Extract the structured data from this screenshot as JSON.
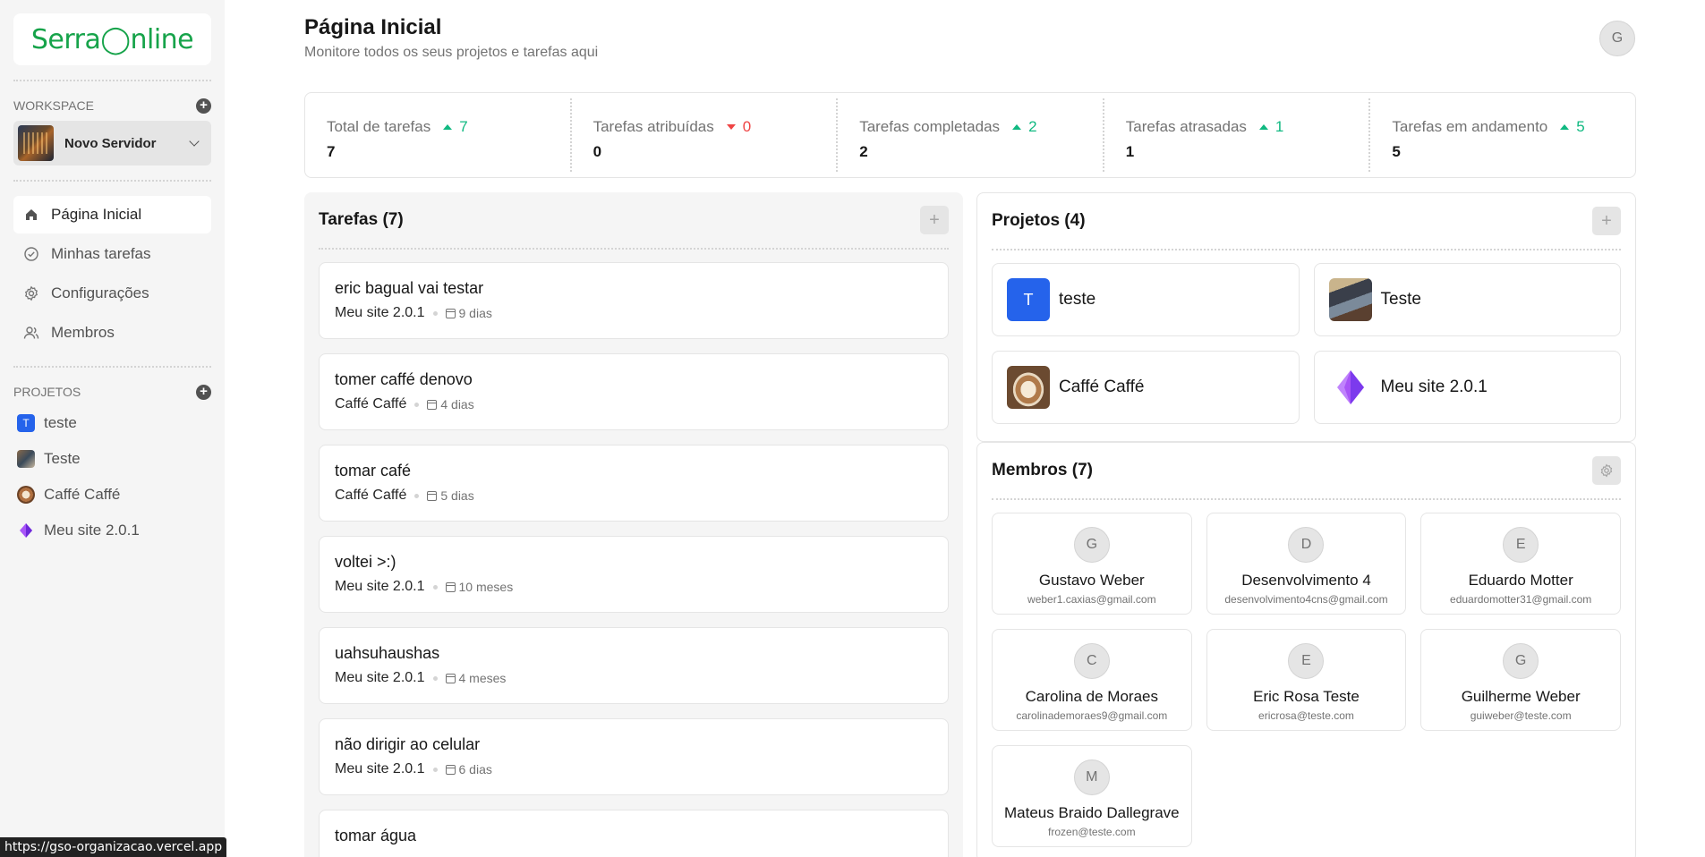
{
  "app": {
    "logo_text_a": "Serra",
    "logo_text_b": "nline",
    "status_url": "https://gso-organizacao.vercel.app"
  },
  "sidebar": {
    "workspace_label": "WORKSPACE",
    "workspace_name": "Novo Servidor",
    "nav": [
      {
        "label": "Página Inicial",
        "icon": "home-icon",
        "active": true
      },
      {
        "label": "Minhas tarefas",
        "icon": "check-circle-icon",
        "active": false
      },
      {
        "label": "Configurações",
        "icon": "gear-icon",
        "active": false
      },
      {
        "label": "Membros",
        "icon": "users-icon",
        "active": false
      }
    ],
    "projects_label": "PROJETOS",
    "projects": [
      {
        "name": "teste",
        "icon_letter": "T"
      },
      {
        "name": "Teste"
      },
      {
        "name": "Caffé Caffé"
      },
      {
        "name": "Meu site 2.0.1"
      }
    ]
  },
  "header": {
    "title": "Página Inicial",
    "subtitle": "Monitore todos os seus projetos e tarefas aqui",
    "avatar_letter": "G"
  },
  "stats": [
    {
      "label": "Total de tarefas",
      "trend": "7",
      "direction": "up",
      "value": "7"
    },
    {
      "label": "Tarefas atribuídas",
      "trend": "0",
      "direction": "down",
      "value": "0"
    },
    {
      "label": "Tarefas completadas",
      "trend": "2",
      "direction": "up",
      "value": "2"
    },
    {
      "label": "Tarefas atrasadas",
      "trend": "1",
      "direction": "up",
      "value": "1"
    },
    {
      "label": "Tarefas em andamento",
      "trend": "5",
      "direction": "up",
      "value": "5"
    }
  ],
  "tasks": {
    "title": "Tarefas (7)",
    "add_label": "+",
    "items": [
      {
        "title": "eric bagual vai testar",
        "project": "Meu site 2.0.1",
        "due": "9 dias"
      },
      {
        "title": "tomer caffé denovo",
        "project": "Caffé Caffé",
        "due": "4 dias"
      },
      {
        "title": "tomar café",
        "project": "Caffé Caffé",
        "due": "5 dias"
      },
      {
        "title": "voltei >:)",
        "project": "Meu site 2.0.1",
        "due": "10 meses"
      },
      {
        "title": "uahsuhaushas",
        "project": "Meu site 2.0.1",
        "due": "4 meses"
      },
      {
        "title": "não dirigir ao celular",
        "project": "Meu site 2.0.1",
        "due": "6 dias"
      },
      {
        "title": "tomar água",
        "project": "",
        "due": ""
      }
    ]
  },
  "projects": {
    "title": "Projetos (4)",
    "add_label": "+",
    "items": [
      {
        "name": "teste",
        "icon_letter": "T"
      },
      {
        "name": "Teste"
      },
      {
        "name": "Caffé Caffé"
      },
      {
        "name": "Meu site 2.0.1"
      }
    ]
  },
  "members": {
    "title": "Membros (7)",
    "items": [
      {
        "initial": "G",
        "name": "Gustavo Weber",
        "email": "weber1.caxias@gmail.com"
      },
      {
        "initial": "D",
        "name": "Desenvolvimento 4",
        "email": "desenvolvimento4cns@gmail.com"
      },
      {
        "initial": "E",
        "name": "Eduardo Motter",
        "email": "eduardomotter31@gmail.com"
      },
      {
        "initial": "C",
        "name": "Carolina de Moraes",
        "email": "carolinademoraes9@gmail.com"
      },
      {
        "initial": "E",
        "name": "Eric Rosa Teste",
        "email": "ericrosa@teste.com"
      },
      {
        "initial": "G",
        "name": "Guilherme Weber",
        "email": "guiweber@teste.com"
      },
      {
        "initial": "M",
        "name": "Mateus Braido Dallegrave",
        "email": "frozen@teste.com"
      }
    ]
  },
  "colors": {
    "accent": "#16a34a",
    "trend_up": "#10b981",
    "trend_down": "#ef4444",
    "project_blue": "#2563eb"
  }
}
